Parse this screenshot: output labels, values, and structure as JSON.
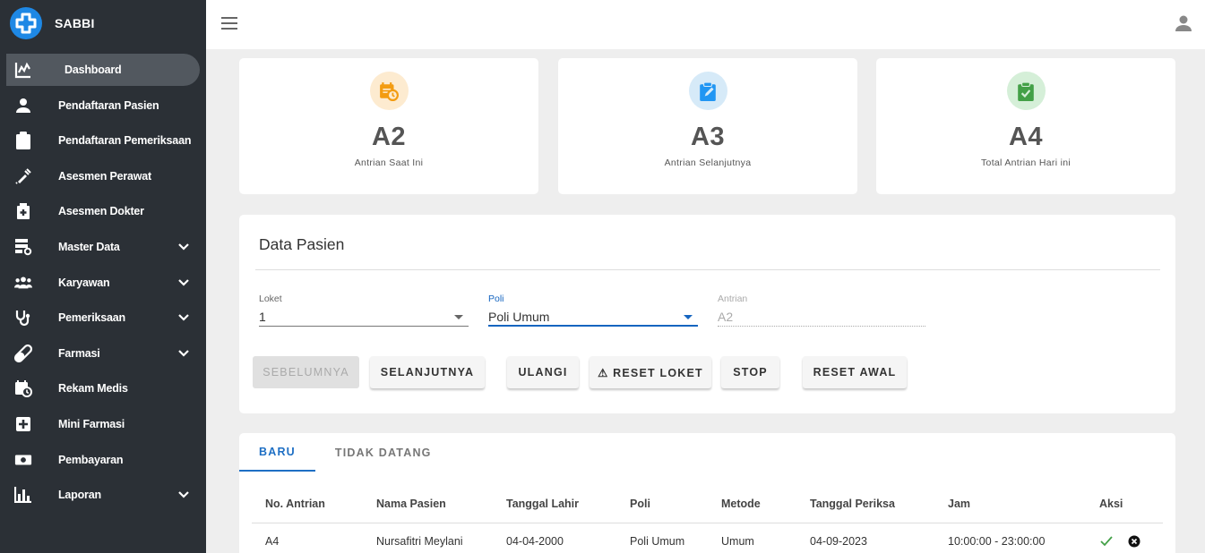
{
  "brand": {
    "name": "SABBI"
  },
  "sidebar": {
    "items": [
      {
        "label": "Dashboard",
        "icon": "chart-line-icon",
        "active": true
      },
      {
        "label": "Pendaftaran Pasien",
        "icon": "person-icon"
      },
      {
        "label": "Pendaftaran Pemeriksaan",
        "icon": "clipboard-icon"
      },
      {
        "label": "Asesmen Perawat",
        "icon": "syringe-icon"
      },
      {
        "label": "Asesmen Dokter",
        "icon": "medical-bag-icon"
      },
      {
        "label": "Master Data",
        "icon": "database-cog-icon",
        "expandable": true
      },
      {
        "label": "Karyawan",
        "icon": "people-icon",
        "expandable": true
      },
      {
        "label": "Pemeriksaan",
        "icon": "stethoscope-icon",
        "expandable": true
      },
      {
        "label": "Farmasi",
        "icon": "pill-icon",
        "expandable": true
      },
      {
        "label": "Rekam Medis",
        "icon": "calendar-clock-icon"
      },
      {
        "label": "Mini Farmasi",
        "icon": "plus-box-icon"
      },
      {
        "label": "Pembayaran",
        "icon": "cash-icon"
      },
      {
        "label": "Laporan",
        "icon": "bar-chart-icon",
        "expandable": true
      }
    ]
  },
  "stats": [
    {
      "value": "A2",
      "label": "Antrian Saat Ini",
      "icon": "calendar-clock-icon",
      "color": "#f39c12",
      "bg": "#fdebd0"
    },
    {
      "value": "A3",
      "label": "Antrian Selanjutnya",
      "icon": "clipboard-edit-icon",
      "color": "#2196f3",
      "bg": "#d6eaf8"
    },
    {
      "value": "A4",
      "label": "Total Antrian Hari ini",
      "icon": "clipboard-check-icon",
      "color": "#43a047",
      "bg": "#d5efd8"
    }
  ],
  "data_pasien": {
    "title": "Data Pasien",
    "loket": {
      "label": "Loket",
      "value": "1"
    },
    "poli": {
      "label": "Poli",
      "value": "Poli Umum"
    },
    "antrian": {
      "label": "Antrian",
      "value": "A2"
    },
    "buttons": {
      "sebelumnya": "SEBELUMNYA",
      "selanjutnya": "SELANJUTNYA",
      "ulangi": "ULANGI",
      "reset_loket": "⚠ RESET LOKET",
      "stop": "STOP",
      "reset_awal": "RESET AWAL"
    }
  },
  "tabs": [
    {
      "label": "BARU",
      "active": true
    },
    {
      "label": "TIDAK DATANG"
    }
  ],
  "table": {
    "headers": [
      "No. Antrian",
      "Nama Pasien",
      "Tanggal Lahir",
      "Poli",
      "Metode",
      "Tanggal Periksa",
      "Jam",
      "Aksi"
    ],
    "rows": [
      [
        "A4",
        "Nursafitri Meylani",
        "04-04-2000",
        "Poli Umum",
        "Umum",
        "04-09-2023",
        "10:00:00 - 23:00:00"
      ]
    ]
  },
  "colors": {
    "sidebar": "#2b3036",
    "accent": "#1e6fc4",
    "check": "#43a047"
  }
}
